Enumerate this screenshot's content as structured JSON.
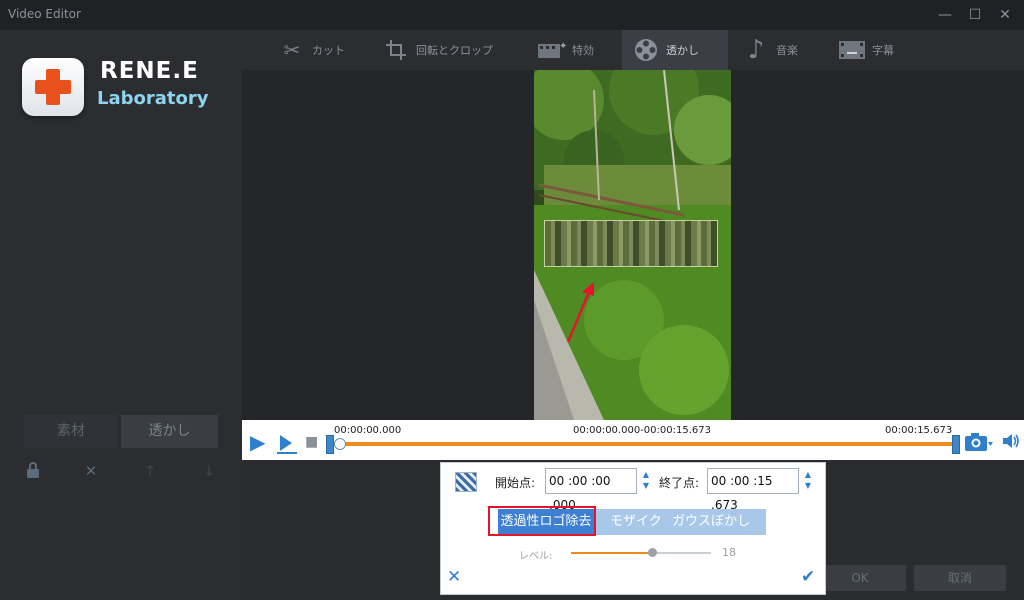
{
  "window": {
    "title": "Video Editor"
  },
  "logo": {
    "name": "RENE.E",
    "sub": "Laboratory"
  },
  "toolbar": {
    "items": [
      {
        "label": "カット",
        "icon": "scissors-icon"
      },
      {
        "label": "回転とクロップ",
        "icon": "crop-icon"
      },
      {
        "label": "特効",
        "icon": "film-effects-icon"
      },
      {
        "label": "透かし",
        "icon": "film-reel-icon"
      },
      {
        "label": "音楽",
        "icon": "music-note-icon"
      },
      {
        "label": "字幕",
        "icon": "subtitle-film-icon"
      }
    ],
    "active": "透かし"
  },
  "left": {
    "tabs": [
      "素材",
      "透かし"
    ],
    "icons": [
      "lock-icon",
      "close-icon",
      "arrow-up-icon",
      "arrow-down-icon"
    ]
  },
  "timeline": {
    "start": "00:00:00.000",
    "range": "00:00:00.000-00:00:15.673",
    "end": "00:00:15.673",
    "position": 0
  },
  "dialog": {
    "start_label": "開始点:",
    "start_value": "00 :00 :00 .000",
    "end_label": "終了点:",
    "end_value": "00 :00 :15 .673",
    "modes": [
      "透過性ロゴ除去",
      "モザイク",
      "ガウスぼかし"
    ],
    "level_label": "レベル:",
    "level_value": "18",
    "level_fraction": 0.58
  },
  "footer": {
    "ok": "OK",
    "cancel": "取消"
  },
  "colors": {
    "accent": "#2f7fcd",
    "timeline": "#f08a1c",
    "highlight": "#e3142b"
  }
}
